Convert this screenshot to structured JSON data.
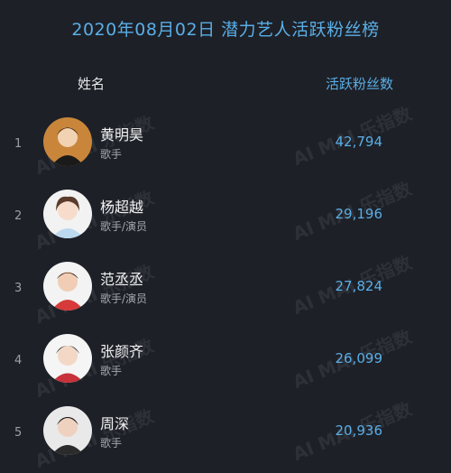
{
  "title": "2020年08月02日 潜力艺人活跃粉丝榜",
  "header": {
    "name_label": "姓名",
    "fans_label": "活跃粉丝数"
  },
  "watermark": "AI MAI 乐指数",
  "rows": [
    {
      "rank": "1",
      "name": "黄明昊",
      "role": "歌手",
      "fans": "42,794",
      "avatar_icon": "avatar-icon",
      "avatar_color": "#c9863a"
    },
    {
      "rank": "2",
      "name": "杨超越",
      "role": "歌手/演员",
      "fans": "29,196",
      "avatar_icon": "avatar-icon",
      "avatar_color": "#f2f2f2"
    },
    {
      "rank": "3",
      "name": "范丞丞",
      "role": "歌手/演员",
      "fans": "27,824",
      "avatar_icon": "avatar-icon",
      "avatar_color": "#d63a3a"
    },
    {
      "rank": "4",
      "name": "张颜齐",
      "role": "歌手",
      "fans": "26,099",
      "avatar_icon": "avatar-icon",
      "avatar_color": "#f5f5f5"
    },
    {
      "rank": "5",
      "name": "周深",
      "role": "歌手",
      "fans": "20,936",
      "avatar_icon": "avatar-icon",
      "avatar_color": "#e9e9e9"
    }
  ]
}
